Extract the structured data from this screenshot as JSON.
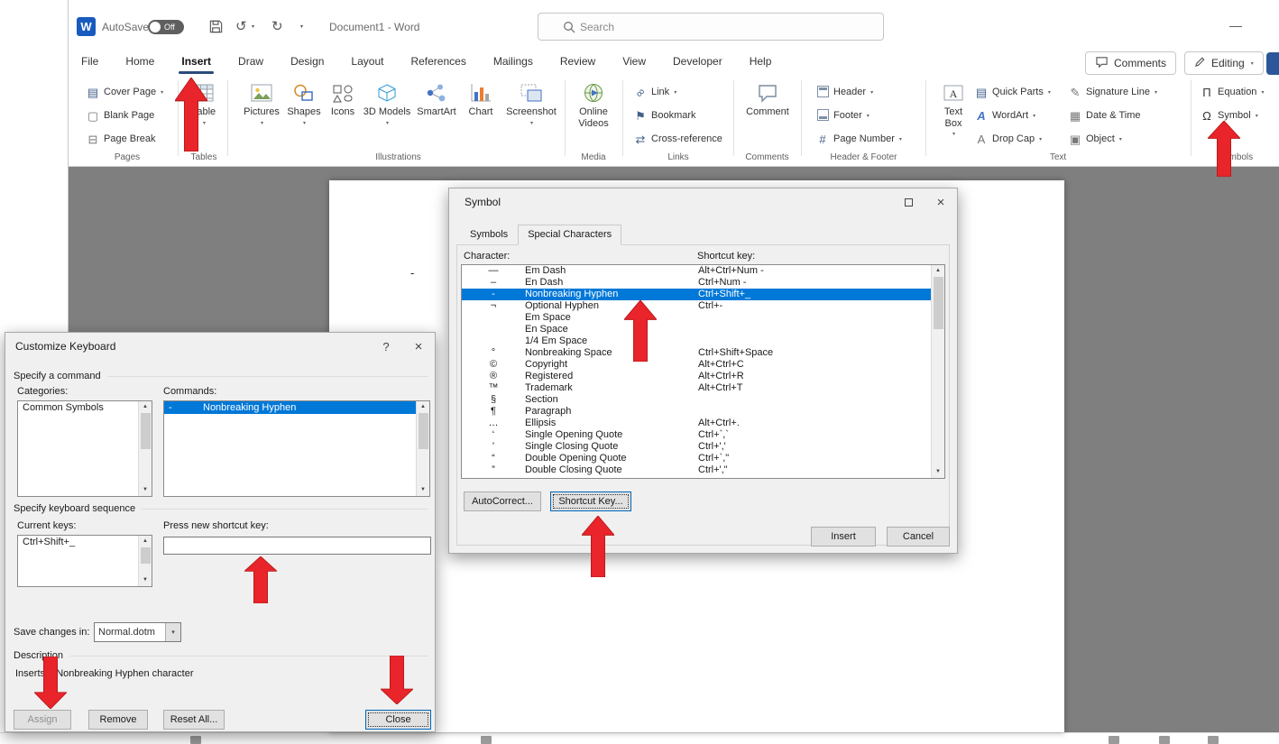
{
  "titlebar": {
    "autosave_label": "AutoSave",
    "autosave_state": "Off",
    "doc_title": "Document1 - Word",
    "search_placeholder": "Search"
  },
  "icons": {
    "word_logo": "W",
    "chevron_down": "▾",
    "undo": "↺",
    "redo": "↻",
    "minimize": "—",
    "close": "×",
    "help": "?",
    "scroll_up": "▲",
    "scroll_down": "▼",
    "cover_page": "▤",
    "blank_page": "▢",
    "page_break": "⊟",
    "link": "∞",
    "bookmark": "⚑",
    "cross_reference": "⇄",
    "page_number": "#",
    "quick_parts": "▤",
    "wordart": "A",
    "drop_cap": "A",
    "signature_line": "✎",
    "date_time": "▦",
    "object": "▣",
    "equation": "Π",
    "symbol_omega": "Ω"
  },
  "ribbon": {
    "tabs": [
      {
        "label": "File"
      },
      {
        "label": "Home"
      },
      {
        "label": "Insert",
        "selected": true
      },
      {
        "label": "Draw"
      },
      {
        "label": "Design"
      },
      {
        "label": "Layout"
      },
      {
        "label": "References"
      },
      {
        "label": "Mailings"
      },
      {
        "label": "Review"
      },
      {
        "label": "View"
      },
      {
        "label": "Developer"
      },
      {
        "label": "Help"
      }
    ],
    "comments_button": "Comments",
    "editing_button": "Editing",
    "groups": {
      "pages": {
        "label": "Pages",
        "cover_page": "Cover Page",
        "blank_page": "Blank Page",
        "page_break": "Page Break"
      },
      "tables": {
        "label": "Tables",
        "table": "Table"
      },
      "illustrations": {
        "label": "Illustrations",
        "pictures": "Pictures",
        "shapes": "Shapes",
        "icons": "Icons",
        "models_3d": "3D Models",
        "smartart": "SmartArt",
        "chart": "Chart",
        "screenshot": "Screenshot"
      },
      "media": {
        "label": "Media",
        "online_videos": "Online Videos"
      },
      "links": {
        "label": "Links",
        "link": "Link",
        "bookmark": "Bookmark",
        "cross_reference": "Cross-reference"
      },
      "comments": {
        "label": "Comments",
        "comment": "Comment"
      },
      "header_footer": {
        "label": "Header & Footer",
        "header": "Header",
        "footer": "Footer",
        "page_number": "Page Number"
      },
      "text": {
        "label": "Text",
        "text_box": "Text Box",
        "quick_parts": "Quick Parts",
        "wordart": "WordArt",
        "drop_cap": "Drop Cap",
        "signature_line": "Signature Line",
        "date_time": "Date & Time",
        "object": "Object"
      },
      "symbols": {
        "label": "Symbols",
        "equation": "Equation",
        "symbol": "Symbol"
      }
    }
  },
  "document": {
    "text": "-"
  },
  "symbol_dialog": {
    "title": "Symbol",
    "tabs": [
      {
        "label": "Symbols"
      },
      {
        "label": "Special Characters",
        "selected": true
      }
    ],
    "character_label": "Character:",
    "shortcut_label": "Shortcut key:",
    "rows": [
      {
        "char": "—",
        "name": "Em Dash",
        "shortcut": "Alt+Ctrl+Num -"
      },
      {
        "char": "–",
        "name": "En Dash",
        "shortcut": "Ctrl+Num -"
      },
      {
        "char": "-",
        "name": "Nonbreaking Hyphen",
        "shortcut": "Ctrl+Shift+_",
        "selected": true
      },
      {
        "char": "¬",
        "name": "Optional Hyphen",
        "shortcut": "Ctrl+-"
      },
      {
        "char": "",
        "name": "Em Space",
        "shortcut": ""
      },
      {
        "char": "",
        "name": "En Space",
        "shortcut": ""
      },
      {
        "char": "",
        "name": "1/4 Em Space",
        "shortcut": ""
      },
      {
        "char": "°",
        "name": "Nonbreaking Space",
        "shortcut": "Ctrl+Shift+Space"
      },
      {
        "char": "©",
        "name": "Copyright",
        "shortcut": "Alt+Ctrl+C"
      },
      {
        "char": "®",
        "name": "Registered",
        "shortcut": "Alt+Ctrl+R"
      },
      {
        "char": "™",
        "name": "Trademark",
        "shortcut": "Alt+Ctrl+T"
      },
      {
        "char": "§",
        "name": "Section",
        "shortcut": ""
      },
      {
        "char": "¶",
        "name": "Paragraph",
        "shortcut": ""
      },
      {
        "char": "…",
        "name": "Ellipsis",
        "shortcut": "Alt+Ctrl+."
      },
      {
        "char": "‘",
        "name": "Single Opening Quote",
        "shortcut": "Ctrl+`,`"
      },
      {
        "char": "’",
        "name": "Single Closing Quote",
        "shortcut": "Ctrl+','"
      },
      {
        "char": "“",
        "name": "Double Opening Quote",
        "shortcut": "Ctrl+`,\""
      },
      {
        "char": "”",
        "name": "Double Closing Quote",
        "shortcut": "Ctrl+',\""
      }
    ],
    "autocorrect_button": "AutoCorrect...",
    "shortcut_key_button": "Shortcut Key...",
    "insert_button": "Insert",
    "cancel_button": "Cancel"
  },
  "customize_dialog": {
    "title": "Customize Keyboard",
    "specify_command": "Specify a command",
    "categories_label": "Categories:",
    "commands_label": "Commands:",
    "categories": [
      {
        "name": "Common Symbols"
      }
    ],
    "commands": [
      {
        "char": "-",
        "name": "Nonbreaking Hyphen",
        "selected": true
      }
    ],
    "specify_sequence": "Specify keyboard sequence",
    "current_keys_label": "Current keys:",
    "new_key_label": "Press new shortcut key:",
    "current_keys": [
      {
        "name": "Ctrl+Shift+_"
      }
    ],
    "new_key_value": "",
    "save_changes_label": "Save changes in:",
    "save_changes_value": "Normal.dotm",
    "description_label": "Description",
    "description_text": "Inserts a Nonbreaking Hyphen character",
    "assign_button": "Assign",
    "remove_button": "Remove",
    "reset_button": "Reset All...",
    "close_button": "Close"
  }
}
